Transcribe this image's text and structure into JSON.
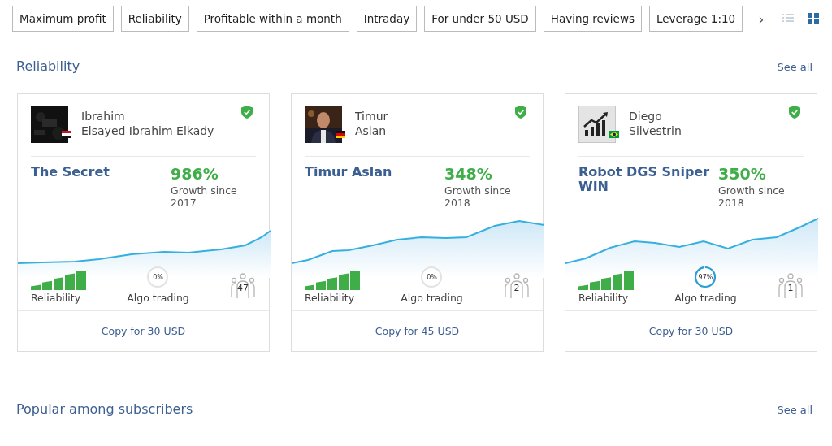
{
  "filters": [
    {
      "label": "Maximum profit"
    },
    {
      "label": "Reliability"
    },
    {
      "label": "Profitable within a month"
    },
    {
      "label": "Intraday"
    },
    {
      "label": "For under 50 USD"
    },
    {
      "label": "Having reviews"
    },
    {
      "label": "Leverage 1:10"
    }
  ],
  "scroll_arrow": "›",
  "views": [
    {
      "kind": "list",
      "selected": false
    },
    {
      "kind": "grid",
      "selected": true
    }
  ],
  "sections": [
    {
      "title": "Reliability",
      "see_all": "See all",
      "cards": [
        {
          "author_first": "Ibrahim",
          "author_last": "Elsayed Ibrahim Elkady",
          "verified": true,
          "signal": "The Secret",
          "growth": "986%",
          "growth_label": "Growth since",
          "since": "2017",
          "reliability": {
            "label": "Reliability"
          },
          "algo": {
            "reading": "0%",
            "label": "Algo trading"
          },
          "subscribers": "47",
          "copy": "Copy for 30 USD"
        },
        {
          "author_first": "Timur",
          "author_last": "Aslan",
          "verified": true,
          "signal": "Timur Aslan",
          "growth": "348%",
          "growth_label": "Growth since",
          "since": "2018",
          "reliability": {
            "label": "Reliability"
          },
          "algo": {
            "reading": "0%",
            "label": "Algo trading"
          },
          "subscribers": "2",
          "copy": "Copy for 45 USD"
        },
        {
          "author_first": "Diego",
          "author_last": "Silvestrin",
          "verified": true,
          "signal": "Robot DGS Sniper WIN",
          "growth": "350%",
          "growth_label": "Growth since",
          "since": "2018",
          "reliability": {
            "label": "Reliability"
          },
          "algo": {
            "reading": "97%",
            "label": "Algo trading"
          },
          "subscribers": "1",
          "copy": "Copy for 30 USD"
        }
      ]
    },
    {
      "title": "Popular among subscribers",
      "see_all": "See all"
    }
  ]
}
